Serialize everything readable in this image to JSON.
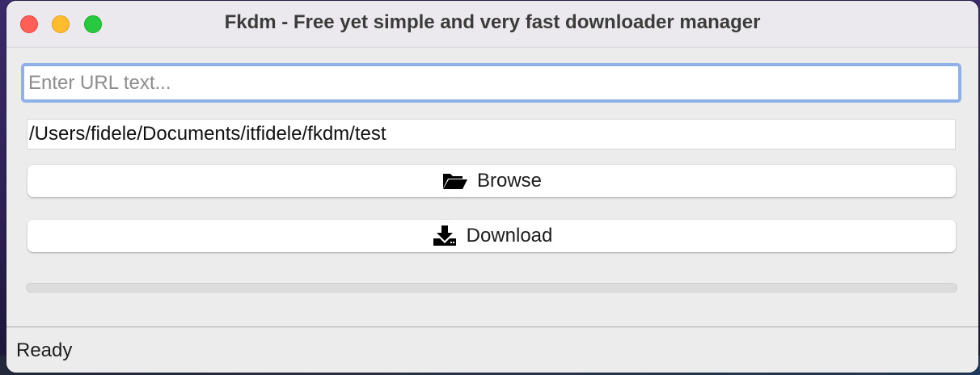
{
  "window": {
    "title": "Fkdm - Free yet simple and very fast downloader manager",
    "controls": {
      "close_color": "#ff5f57",
      "minimize_color": "#febc2e",
      "zoom_color": "#28c840"
    }
  },
  "url_input": {
    "value": "",
    "placeholder": "Enter URL text..."
  },
  "path_input": {
    "value": "/Users/fidele/Documents/itfidele/fkdm/test"
  },
  "buttons": {
    "browse": {
      "label": "Browse",
      "icon": "folder-open-icon"
    },
    "download": {
      "label": "Download",
      "icon": "download-icon"
    }
  },
  "progress": {
    "value": 0
  },
  "status": {
    "text": "Ready"
  },
  "colors": {
    "focus_ring": "#8fb1e8",
    "progress_fill": "#2f7cf6"
  }
}
